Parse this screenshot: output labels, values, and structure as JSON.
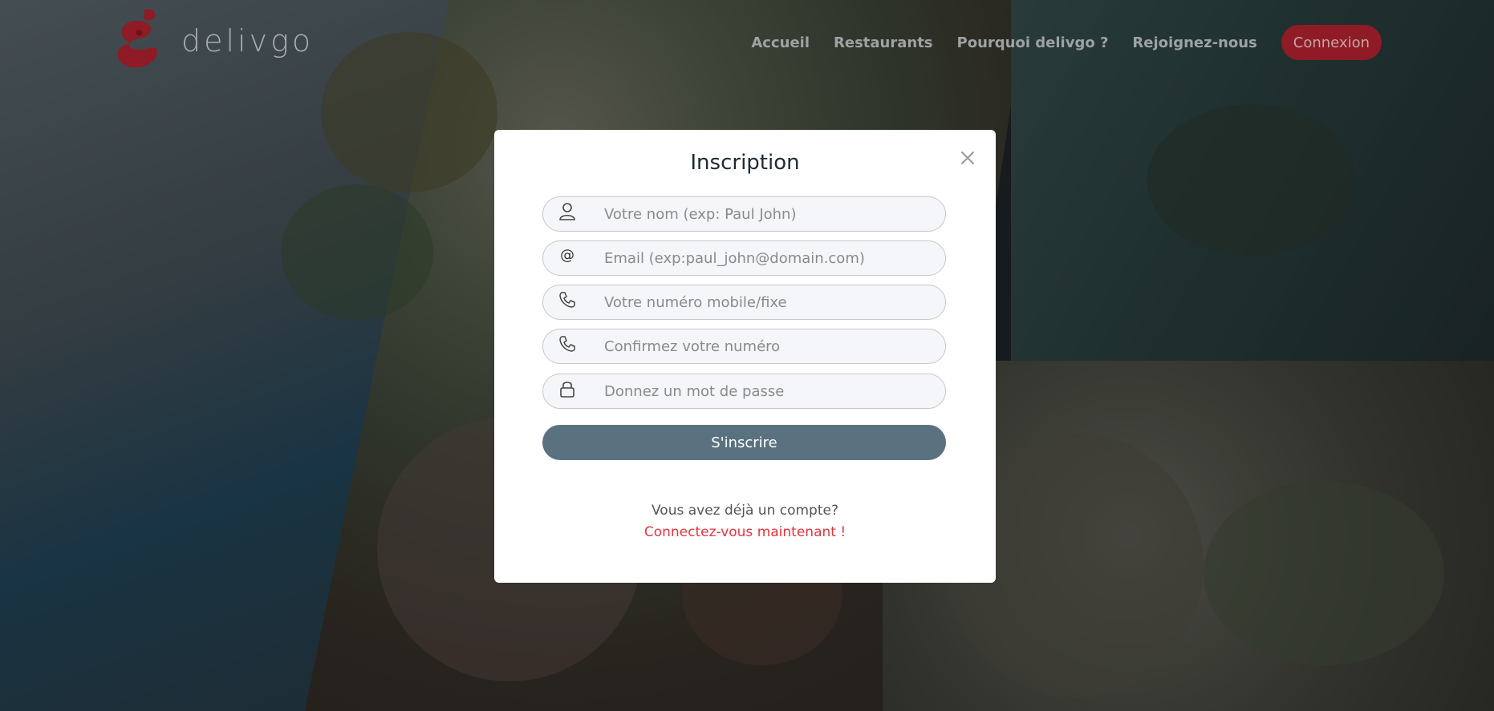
{
  "header": {
    "brand": "delivgo",
    "nav": [
      "Accueil",
      "Restaurants",
      "Pourquoi delivgo ?",
      "Rejoignez-nous"
    ],
    "login_label": "Connexion"
  },
  "modal": {
    "title": "Inscription",
    "fields": [
      {
        "icon": "user-icon",
        "placeholder": "Votre nom (exp: Paul John)",
        "value": ""
      },
      {
        "icon": "at-icon",
        "placeholder": "Email (exp:paul_john@domain.com)",
        "value": ""
      },
      {
        "icon": "phone-icon",
        "placeholder": "Votre numéro mobile/fixe",
        "value": ""
      },
      {
        "icon": "phone-icon",
        "placeholder": "Confirmez votre numéro",
        "value": ""
      },
      {
        "icon": "lock-icon",
        "placeholder": "Donnez un mot de passe",
        "value": ""
      }
    ],
    "submit_label": "S'inscrire",
    "have_account": "Vous avez déjà un compte?",
    "login_link": "Connectez-vous maintenant !"
  },
  "colors": {
    "brand_red": "#e5343e",
    "nav_button_bg": "#8e1b25",
    "submit_bg": "#5a7280",
    "modal_bg": "#ffffff",
    "overlay": "rgba(0,0,0,0.45)"
  }
}
